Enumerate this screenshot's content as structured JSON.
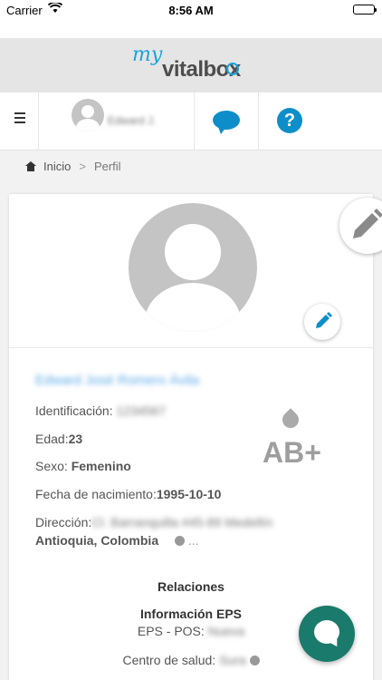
{
  "status_bar": {
    "carrier": "Carrier",
    "time": "8:56 AM"
  },
  "logo": {
    "my": "my",
    "brand": "vitalbox"
  },
  "nav": {
    "user_name": "Edward J."
  },
  "breadcrumb": {
    "home": "Inicio",
    "separator": ">",
    "current": "Perfil"
  },
  "profile": {
    "full_name": "Edward José Romero Ávila",
    "id_label": "Identificación:",
    "id_value": "1234567",
    "age_label": "Edad:",
    "age_value": "23",
    "sex_label": "Sexo:",
    "sex_value": "Femenino",
    "birth_label": "Fecha de nacimiento:",
    "birth_value": "1995-10-10",
    "address_label": "Dirección:",
    "address_value": "Cl. Barranquilla #45-89 Medellín",
    "address_region": "Antioquia, Colombia",
    "address_more": "...",
    "blood_type": "AB+"
  },
  "relations": {
    "title": "Relaciones",
    "eps_title": "Información EPS",
    "eps_label": "EPS - POS:",
    "eps_value": "Nueva",
    "health_center_label": "Centro de salud:",
    "health_center_value": "Sura"
  },
  "colors": {
    "accent": "#0e8ec9",
    "brand_light": "#19a3d9",
    "fab": "#1a7a6b"
  },
  "icons": [
    "wifi-icon",
    "battery-icon",
    "hamburger-icon",
    "chat-icon",
    "help-icon",
    "home-icon",
    "pencil-icon",
    "blood-drop-icon",
    "globe-icon",
    "chat-bubble-icon"
  ]
}
